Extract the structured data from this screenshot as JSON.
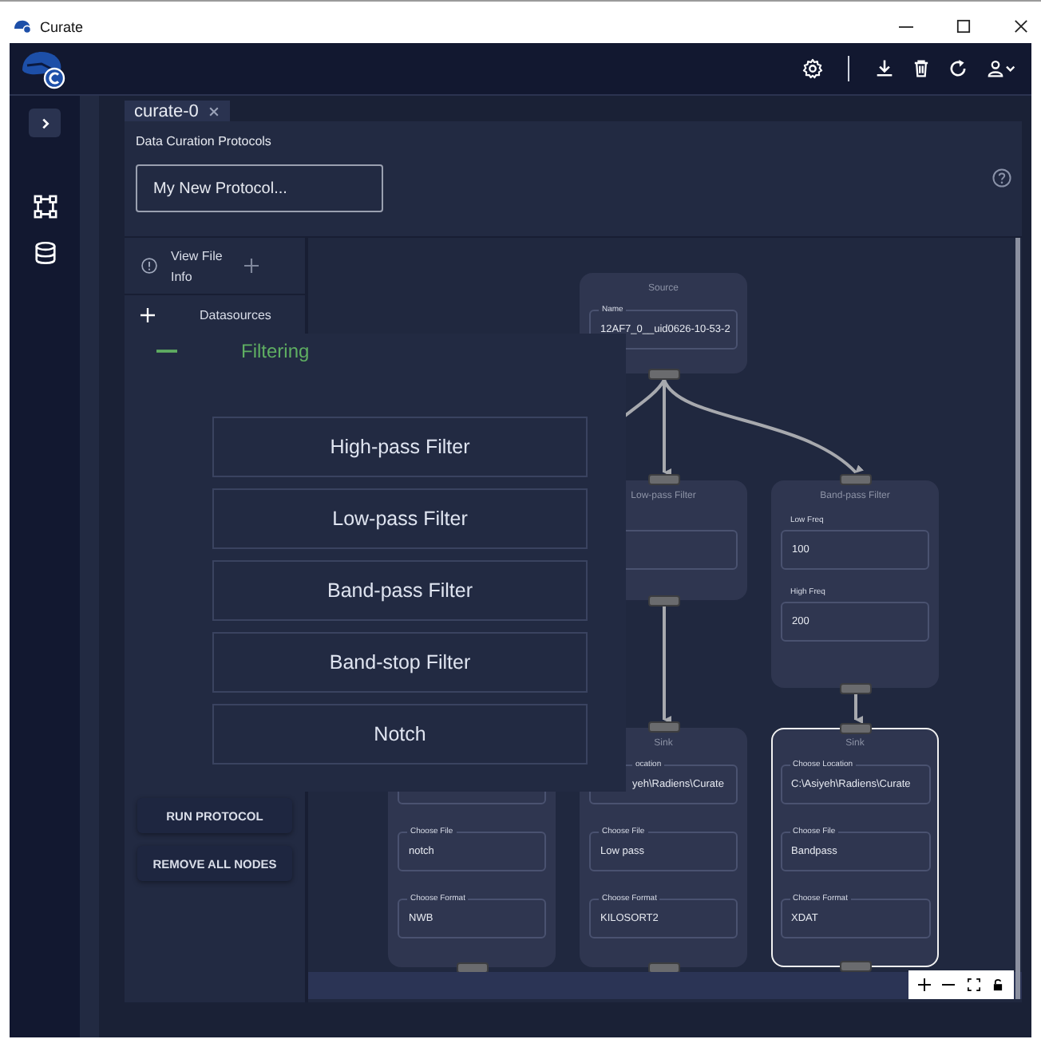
{
  "window": {
    "title": "Curate"
  },
  "tabs": [
    {
      "label": "curate-0",
      "selected": true
    }
  ],
  "panel": {
    "title": "Data Curation Protocols",
    "protocol_name": {
      "value": "My New Protocol..."
    }
  },
  "side_menu": [
    {
      "label": "View File Info",
      "kind": "info",
      "expanded": false
    },
    {
      "label": "Datasources",
      "kind": "plain",
      "expanded": false
    }
  ],
  "node_menu": {
    "category": "Filtering",
    "expanded": true,
    "items": [
      "High-pass Filter",
      "Low-pass Filter",
      "Band-pass Filter",
      "Band-stop Filter",
      "Notch"
    ]
  },
  "actions": [
    "RUN PROTOCOL",
    "REMOVE ALL NODES"
  ],
  "nodes": [
    {
      "title": "Source",
      "selected": false,
      "fields": [
        {
          "kind": "outlined",
          "label": "Name",
          "value": "12AF7_0__uid0626-10-53-2"
        }
      ]
    },
    {
      "title": "Low-pass Filter",
      "selected": false,
      "fields": [
        {
          "kind": "stacked"
        }
      ]
    },
    {
      "title": "Band-pass Filter",
      "selected": false,
      "fields": [
        {
          "kind": "stacked",
          "label": "Low Freq",
          "value": "100"
        },
        {
          "kind": "stacked",
          "label": "High Freq",
          "value": "200"
        }
      ]
    },
    {
      "selected": false,
      "fields": [
        {
          "kind": "outlined"
        },
        {
          "kind": "outlined",
          "label": "Choose File",
          "value": "notch"
        },
        {
          "kind": "outlined",
          "label": "Choose Format",
          "value": "NWB"
        }
      ]
    },
    {
      "title": "Sink",
      "selected": false,
      "fields": [
        {
          "kind": "partial",
          "label": "ocation",
          "value": "yeh\\Radiens\\Curate"
        },
        {
          "kind": "outlined",
          "label": "Choose File",
          "value": "Low pass"
        },
        {
          "kind": "outlined",
          "label": "Choose Format",
          "value": "KILOSORT2"
        }
      ]
    },
    {
      "title": "Sink",
      "selected": true,
      "fields": [
        {
          "kind": "outlined",
          "label": "Choose Location",
          "value": "C:\\Asiyeh\\Radiens\\Curate"
        },
        {
          "kind": "outlined",
          "label": "Choose File",
          "value": "Bandpass"
        },
        {
          "kind": "outlined",
          "label": "Choose Format",
          "value": "XDAT"
        }
      ]
    }
  ]
}
